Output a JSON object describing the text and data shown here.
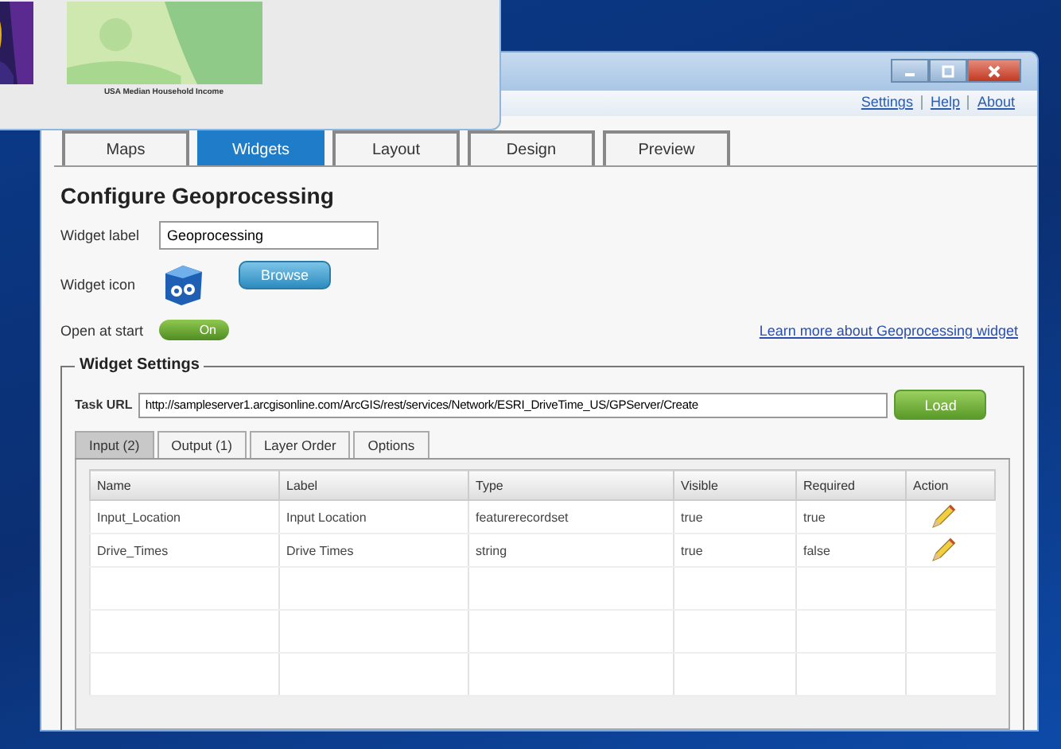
{
  "background_window": {
    "thumbnails": [
      {
        "kind": "picture"
      },
      {
        "kind": "picture",
        "caption": "USA Median Household Income"
      }
    ]
  },
  "window": {
    "links": [
      "Settings",
      "Help",
      "About"
    ]
  },
  "tabs": [
    {
      "label": "Maps",
      "selected": false
    },
    {
      "label": "Widgets",
      "selected": true
    },
    {
      "label": "Layout",
      "selected": false
    },
    {
      "label": "Design",
      "selected": false
    },
    {
      "label": "Preview",
      "selected": false
    }
  ],
  "heading": "Configure Geoprocessing",
  "widget_label": {
    "label": "Widget label",
    "value": "Geoprocessing"
  },
  "widget_icon": {
    "label": "Widget icon",
    "button": "Browse"
  },
  "open_at_start": {
    "label": "Open at start",
    "on": true,
    "text": "On"
  },
  "learn_more_link": "Learn more about Geoprocessing widget",
  "widget_settings": {
    "legend": "Widget Settings",
    "task_url_label": "Task URL",
    "task_url": "http://sampleserver1.arcgisonline.com/ArcGIS/rest/services/Network/ESRI_DriveTime_US/GPServer/Create",
    "load_button": "Load",
    "subtabs": [
      {
        "label": "Input (2)",
        "selected": true
      },
      {
        "label": "Output (1)",
        "selected": false
      },
      {
        "label": "Layer Order",
        "selected": false
      },
      {
        "label": "Options",
        "selected": false
      }
    ],
    "table": {
      "columns": [
        "Name",
        "Label",
        "Type",
        "Visible",
        "Required",
        "Action"
      ],
      "rows": [
        {
          "name": "Input_Location",
          "label": "Input Location",
          "type": "featurerecordset",
          "visible": "true",
          "required": "true"
        },
        {
          "name": "Drive_Times",
          "label": "Drive Times",
          "type": "string",
          "visible": "true",
          "required": "false"
        }
      ]
    }
  }
}
